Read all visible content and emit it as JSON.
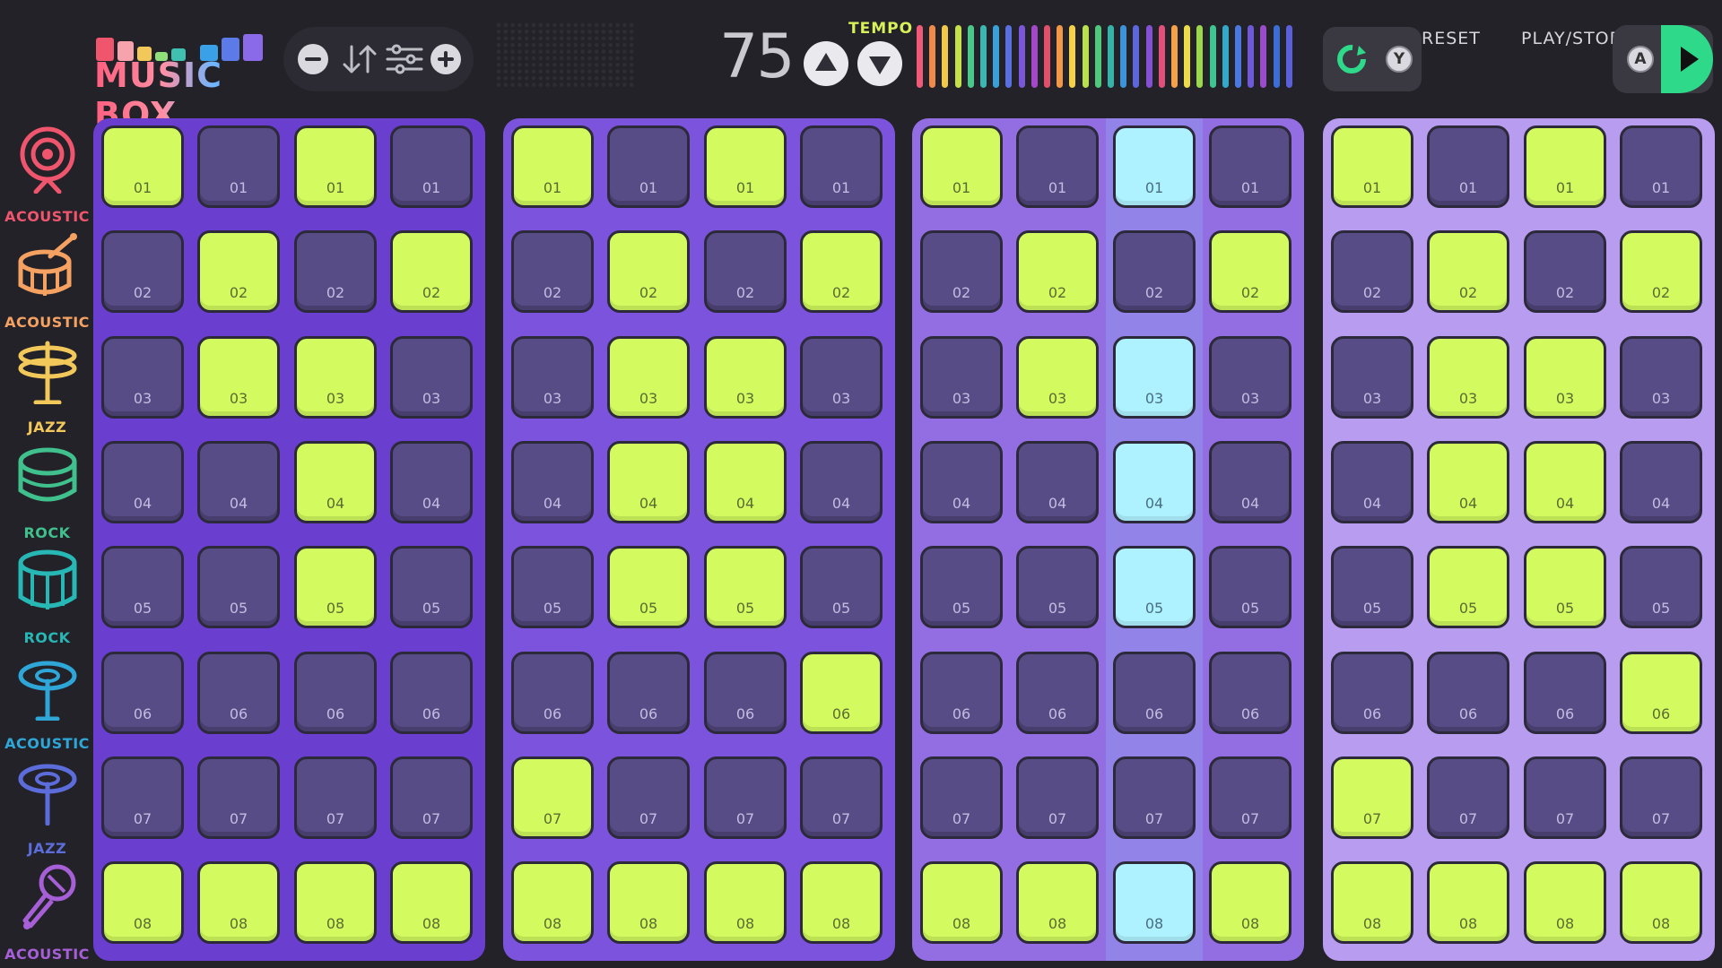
{
  "app": {
    "logo_text": "MUSIC BOX"
  },
  "toolbar": {
    "tools": [
      "minus-icon",
      "sort-arrows-icon",
      "sliders-icon",
      "plus-icon"
    ]
  },
  "tempo": {
    "label": "TEMPO",
    "value": "75"
  },
  "controls": {
    "reset_label": "RESET",
    "reset_badge": "Y",
    "play_label": "PLAY/STOP",
    "play_badge": "A"
  },
  "colors": {
    "background": "#232228",
    "pad_off": "#574c86",
    "pad_on": "#d3fb5f",
    "pad_playing": "#aef1ff",
    "play_green": "#2ed98a",
    "panel_colors": [
      "#6a3fd0",
      "#7c53dc",
      "#936ee2",
      "#b79cf0"
    ],
    "meter_colors": [
      "#f05a78",
      "#f08a4a",
      "#f0c84a",
      "#c6e04a",
      "#4ac889",
      "#39b7b0",
      "#3aa0d8",
      "#5a70e0",
      "#7a56d8",
      "#a448c8",
      "#e0506a",
      "#f0974a",
      "#f5d14a",
      "#b8e14c",
      "#4fc87c",
      "#35b3a8",
      "#3b93d9",
      "#5c66dd",
      "#8450d4",
      "#e0507a",
      "#f5a04a",
      "#eddc4a",
      "#9bd84e",
      "#3ec48e",
      "#34a8c8",
      "#4b78e0",
      "#6e5ad8",
      "#9a4ccc",
      "#3b6fd6",
      "#5a5fda"
    ]
  },
  "sidebar": {
    "instruments": [
      {
        "label": "ACOUSTIC",
        "icon": "snare-drum-icon",
        "color": "#f0556e"
      },
      {
        "label": "ACOUSTIC",
        "icon": "drum-with-sticks-icon",
        "color": "#f5a161"
      },
      {
        "label": "JAZZ",
        "icon": "hi-hat-icon",
        "color": "#f3c85a"
      },
      {
        "label": "ROCK",
        "icon": "tom-drum-icon",
        "color": "#3fc08c"
      },
      {
        "label": "ROCK",
        "icon": "floor-tom-icon",
        "color": "#27b7b5"
      },
      {
        "label": "ACOUSTIC",
        "icon": "cymbal-icon",
        "color": "#2fa6d8"
      },
      {
        "label": "JAZZ",
        "icon": "ride-cymbal-icon",
        "color": "#5c6ddb"
      },
      {
        "label": "ACOUSTIC",
        "icon": "microphone-icon",
        "color": "#a65fd6"
      }
    ]
  },
  "row_labels": [
    "01",
    "02",
    "03",
    "04",
    "05",
    "06",
    "07",
    "08"
  ],
  "patterns": [
    {
      "name": "pattern-1",
      "grid": [
        [
          1,
          0,
          1,
          0
        ],
        [
          0,
          1,
          0,
          1
        ],
        [
          0,
          1,
          1,
          0
        ],
        [
          0,
          0,
          1,
          0
        ],
        [
          0,
          0,
          1,
          0
        ],
        [
          0,
          0,
          0,
          0
        ],
        [
          0,
          0,
          0,
          0
        ],
        [
          1,
          1,
          1,
          1
        ]
      ]
    },
    {
      "name": "pattern-2",
      "grid": [
        [
          1,
          0,
          1,
          0
        ],
        [
          0,
          1,
          0,
          1
        ],
        [
          0,
          1,
          1,
          0
        ],
        [
          0,
          1,
          1,
          0
        ],
        [
          0,
          1,
          1,
          0
        ],
        [
          0,
          0,
          0,
          1
        ],
        [
          1,
          0,
          0,
          0
        ],
        [
          1,
          1,
          1,
          1
        ]
      ]
    },
    {
      "name": "pattern-3",
      "playing_column": 2,
      "grid": [
        [
          1,
          0,
          2,
          0
        ],
        [
          0,
          1,
          0,
          1
        ],
        [
          0,
          1,
          2,
          0
        ],
        [
          0,
          0,
          2,
          0
        ],
        [
          0,
          0,
          2,
          0
        ],
        [
          0,
          0,
          0,
          0
        ],
        [
          0,
          0,
          0,
          0
        ],
        [
          1,
          1,
          2,
          1
        ]
      ]
    },
    {
      "name": "pattern-4",
      "grid": [
        [
          1,
          0,
          1,
          0
        ],
        [
          0,
          1,
          0,
          1
        ],
        [
          0,
          1,
          1,
          0
        ],
        [
          0,
          1,
          1,
          0
        ],
        [
          0,
          1,
          1,
          0
        ],
        [
          0,
          0,
          0,
          1
        ],
        [
          1,
          0,
          0,
          0
        ],
        [
          1,
          1,
          1,
          1
        ]
      ]
    }
  ]
}
